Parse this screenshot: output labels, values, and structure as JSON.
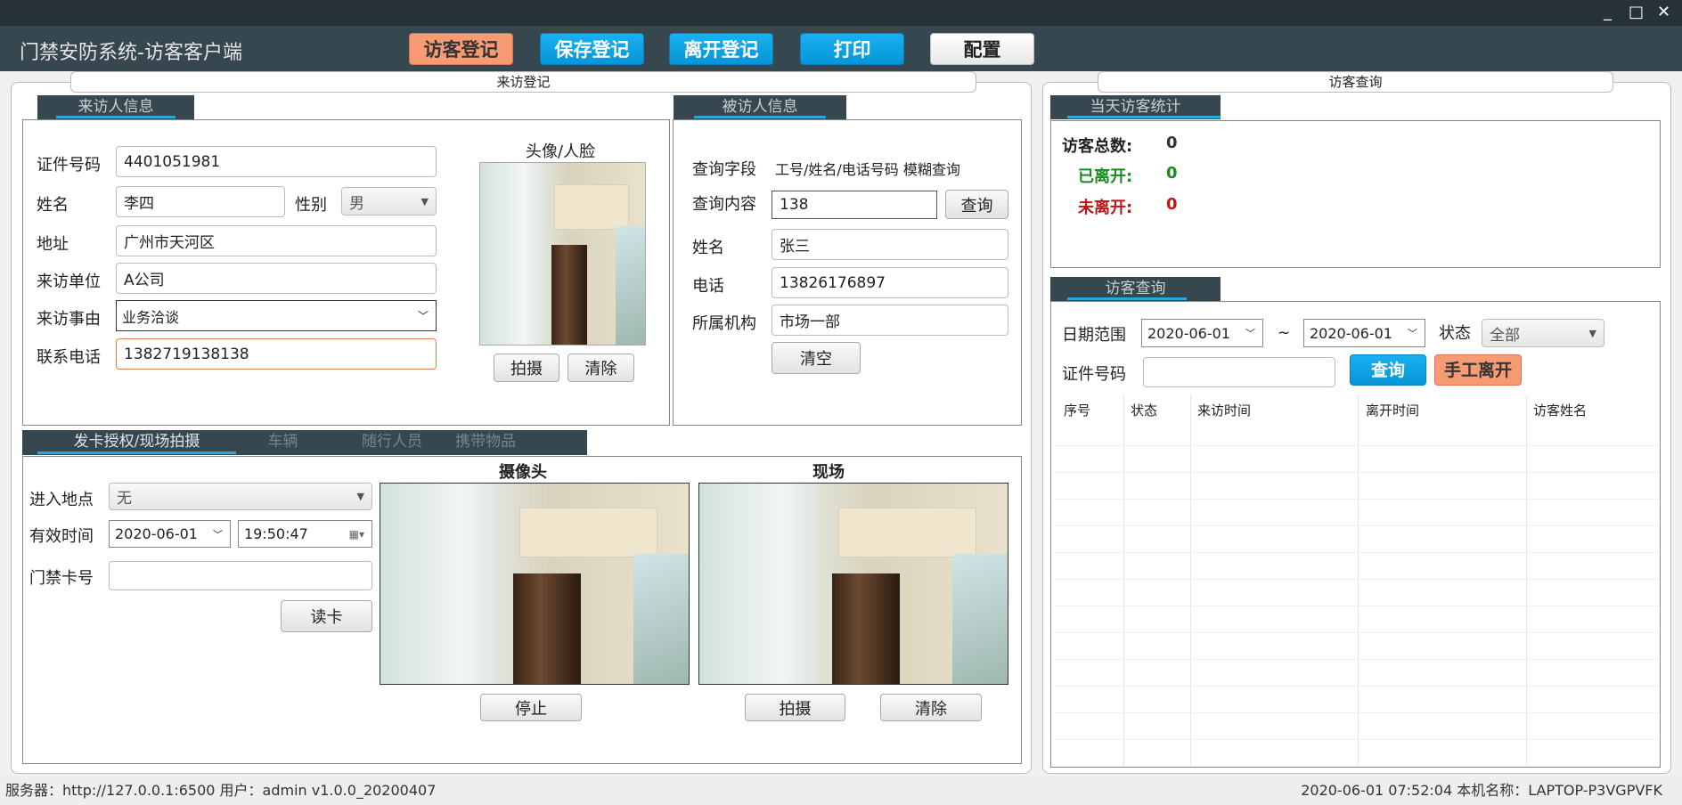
{
  "window": {
    "title": "门禁安防系统-访客客户端",
    "controls": {
      "minimize": "_",
      "maximize": "□",
      "close": "✕"
    }
  },
  "toolbar": {
    "register": "访客登记",
    "save": "保存登记",
    "leave": "离开登记",
    "print": "打印",
    "config": "配置"
  },
  "left_panel": {
    "legend": "来访登记",
    "visitor_tab": "来访人信息",
    "visitor": {
      "id_label": "证件号码",
      "id_value": "4401051981",
      "name_label": "姓名",
      "name_value": "李四",
      "gender_label": "性别",
      "gender_value": "男",
      "address_label": "地址",
      "address_value": "广州市天河区",
      "company_label": "来访单位",
      "company_value": "A公司",
      "reason_label": "来访事由",
      "reason_value": "业务洽谈",
      "phone_label": "联系电话",
      "phone_value": "1382719138138",
      "photo_label": "头像/人脸",
      "shoot_button": "拍摄",
      "clear_button": "清除"
    },
    "host_tab": "被访人信息",
    "host": {
      "field_label": "查询字段",
      "field_value": "工号/姓名/电话号码 模糊查询",
      "content_label": "查询内容",
      "content_value": "138",
      "query_button": "查询",
      "name_label": "姓名",
      "name_value": "张三",
      "phone_label": "电话",
      "phone_value": "13826176897",
      "org_label": "所属机构",
      "org_value": "市场一部",
      "clear_button": "清空"
    },
    "bottom_tabs": [
      "发卡授权/现场拍摄",
      "车辆",
      "随行人员",
      "携带物品"
    ],
    "card": {
      "location_label": "进入地点",
      "location_value": "无",
      "valid_label": "有效时间",
      "valid_date": "2020-06-01",
      "valid_time": "19:50:47",
      "card_label": "门禁卡号",
      "card_value": "",
      "read_button": "读卡"
    },
    "camera": {
      "label": "摄像头",
      "stop_button": "停止"
    },
    "scene": {
      "label": "现场",
      "shoot_button": "拍摄",
      "clear_button": "清除"
    }
  },
  "right_panel": {
    "legend": "访客查询",
    "stats_tab": "当天访客统计",
    "stats": {
      "total_label": "访客总数:",
      "total": "0",
      "left_label": "已离开:",
      "left": "0",
      "not_left_label": "未离开:",
      "not_left": "0"
    },
    "query_tab": "访客查询",
    "query": {
      "date_label": "日期范围",
      "date_from": "2020-06-01",
      "tilde": "~",
      "date_to": "2020-06-01",
      "status_label": "状态",
      "status_value": "全部",
      "id_label": "证件号码",
      "id_value": "",
      "query_button": "查询",
      "manual_leave_button": "手工离开"
    },
    "table": {
      "columns": [
        "序号",
        "状态",
        "来访时间",
        "离开时间",
        "访客姓名"
      ],
      "rows": []
    }
  },
  "statusbar": {
    "server": "服务器：http://127.0.0.1:6500  用户：admin  v1.0.0_20200407",
    "right": "2020-06-01 07:52:04  本机名称：LAPTOP-P3VGPVFK"
  }
}
